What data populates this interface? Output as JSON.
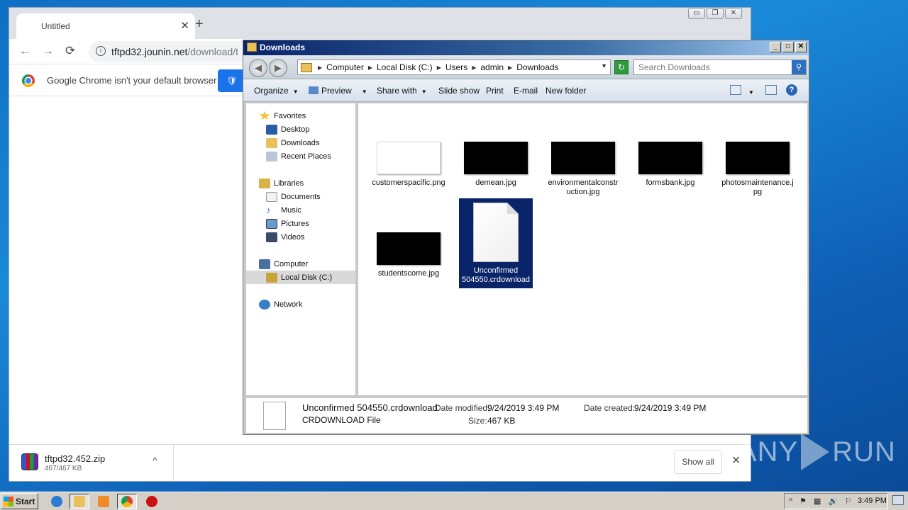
{
  "chrome": {
    "tab_title": "Untitled",
    "tab_close": "✕",
    "new_tab": "+",
    "nav_back": "←",
    "nav_forward": "→",
    "reload": "⟳",
    "url_host": "tftpd32.jounin.net",
    "url_path": "/download/t",
    "infobar_message": "Google Chrome isn't your default browser",
    "window_controls": [
      "▭",
      "❐",
      "✕"
    ],
    "download": {
      "filename": "tftpd32.452.zip",
      "size": "467/467 KB",
      "chevron": "^"
    },
    "show_all": "Show all",
    "download_close": "✕"
  },
  "explorer": {
    "title": "Downloads",
    "title_controls": [
      "_",
      "□",
      "✕"
    ],
    "nav_back_glyph": "◀",
    "nav_forward_glyph": "▶",
    "breadcrumb": [
      "Computer",
      "Local Disk (C:)",
      "Users",
      "admin",
      "Downloads"
    ],
    "search_placeholder": "Search Downloads",
    "search_icon": "⚲",
    "refresh_glyph": "↻",
    "commands": {
      "organize": "Organize",
      "preview": "Preview",
      "share_with": "Share with",
      "slide_show": "Slide show",
      "print": "Print",
      "email": "E-mail",
      "new_folder": "New folder"
    },
    "nav": {
      "favorites": "Favorites",
      "desktop": "Desktop",
      "downloads": "Downloads",
      "recent_places": "Recent Places",
      "libraries": "Libraries",
      "documents": "Documents",
      "music": "Music",
      "pictures": "Pictures",
      "videos": "Videos",
      "computer": "Computer",
      "local_disk": "Local Disk (C:)",
      "network": "Network"
    },
    "files": [
      {
        "name": "customerspacific.png"
      },
      {
        "name": "demean.jpg"
      },
      {
        "name": "environmentalconstruction.jpg"
      },
      {
        "name": "formsbank.jpg"
      },
      {
        "name": "photosmaintenance.jpg"
      },
      {
        "name": "studentscome.jpg"
      },
      {
        "name": "Unconfirmed 504550.crdownload"
      }
    ],
    "details": {
      "name": "Unconfirmed 504550.crdownload",
      "type": "CRDOWNLOAD File",
      "date_modified_label": "Date modified:",
      "date_modified": "9/24/2019 3:49 PM",
      "date_created_label": "Date created:",
      "date_created": "9/24/2019 3:49 PM",
      "size_label": "Size:",
      "size": "467 KB"
    }
  },
  "watermark": {
    "left": "ANY",
    "right": "RUN"
  },
  "taskbar": {
    "start_label": "Start",
    "clock": "3:49 PM",
    "tray_expand": "^"
  },
  "colors": {
    "explorer_title_start": "#0a246a",
    "selection": "#0a246a",
    "chrome_blue": "#1a73e8"
  }
}
